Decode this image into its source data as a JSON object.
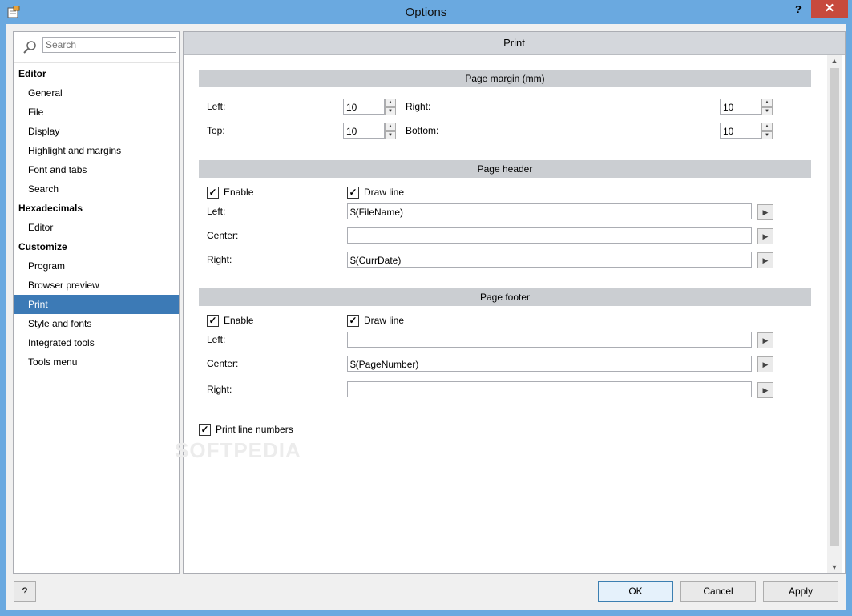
{
  "window": {
    "title": "Options",
    "help_label": "?",
    "close_label": "✕"
  },
  "search": {
    "placeholder": "Search",
    "value": ""
  },
  "tree": [
    {
      "type": "group",
      "label": "Editor"
    },
    {
      "type": "item",
      "label": "General"
    },
    {
      "type": "item",
      "label": "File"
    },
    {
      "type": "item",
      "label": "Display"
    },
    {
      "type": "item",
      "label": "Highlight and margins"
    },
    {
      "type": "item",
      "label": "Font and tabs"
    },
    {
      "type": "item",
      "label": "Search"
    },
    {
      "type": "group",
      "label": "Hexadecimals"
    },
    {
      "type": "item",
      "label": "Editor"
    },
    {
      "type": "group",
      "label": "Customize"
    },
    {
      "type": "item",
      "label": "Program"
    },
    {
      "type": "item",
      "label": "Browser preview"
    },
    {
      "type": "item",
      "label": "Print",
      "selected": true
    },
    {
      "type": "item",
      "label": "Style and fonts"
    },
    {
      "type": "item",
      "label": "Integrated tools"
    },
    {
      "type": "item",
      "label": "Tools menu"
    }
  ],
  "panel": {
    "title": "Print"
  },
  "margin": {
    "header": "Page margin (mm)",
    "left_label": "Left:",
    "left_value": "10",
    "right_label": "Right:",
    "right_value": "10",
    "top_label": "Top:",
    "top_value": "10",
    "bottom_label": "Bottom:",
    "bottom_value": "10"
  },
  "page_header": {
    "header": "Page header",
    "enable_label": "Enable",
    "enable_checked": true,
    "drawline_label": "Draw line",
    "drawline_checked": true,
    "left_label": "Left:",
    "left_value": "$(FileName)",
    "center_label": "Center:",
    "center_value": "",
    "right_label": "Right:",
    "right_value": "$(CurrDate)"
  },
  "page_footer": {
    "header": "Page footer",
    "enable_label": "Enable",
    "enable_checked": true,
    "drawline_label": "Draw line",
    "drawline_checked": true,
    "left_label": "Left:",
    "left_value": "",
    "center_label": "Center:",
    "center_value": "$(PageNumber)",
    "right_label": "Right:",
    "right_value": ""
  },
  "print_line_numbers": {
    "label": "Print line numbers",
    "checked": true
  },
  "watermark": "SOFTPEDIA",
  "buttons": {
    "help": "?",
    "ok": "OK",
    "cancel": "Cancel",
    "apply": "Apply"
  },
  "colors": {
    "selection": "#3c7ab6",
    "close": "#c74a3d",
    "titlebar": "#6aa9e0"
  }
}
